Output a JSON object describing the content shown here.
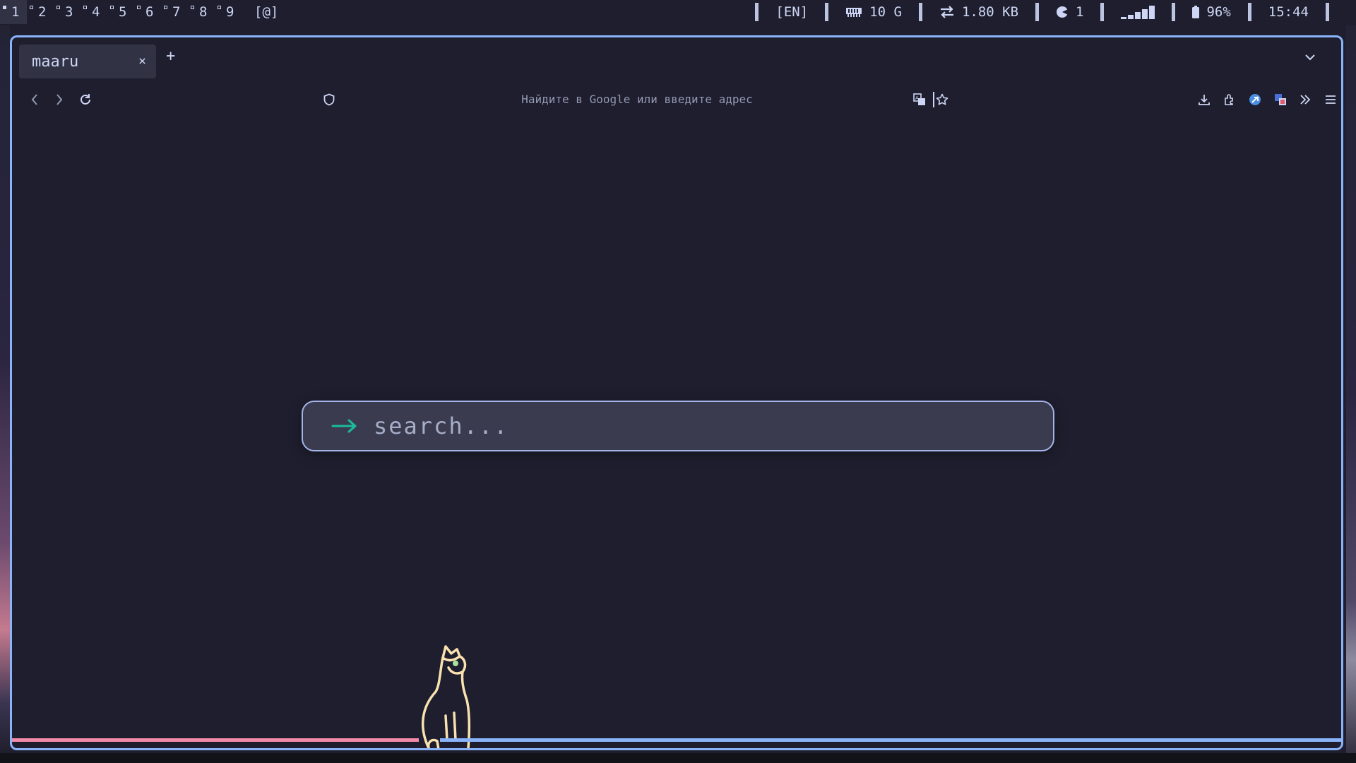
{
  "topbar": {
    "workspaces": [
      "1",
      "2",
      "3",
      "4",
      "5",
      "6",
      "7",
      "8",
      "9"
    ],
    "active_workspace": "1",
    "layout_indicator": "[@]",
    "keyboard_layout": "[EN]",
    "memory": "10 G",
    "network": "1.80 KB",
    "updates": "1",
    "battery": "96%",
    "clock": "15:44"
  },
  "browser": {
    "tab_title": "maaru",
    "tab_close": "×",
    "new_tab": "+",
    "url_placeholder": "Найдите в Google или введите адрес"
  },
  "page": {
    "search_placeholder": "search..."
  },
  "colors": {
    "background": "#1e1e2e",
    "accent_blue": "#89b4fa",
    "accent_pink": "#f38ba8",
    "arrow_teal": "#1abc9c",
    "cat_cream": "#f9e2af"
  }
}
